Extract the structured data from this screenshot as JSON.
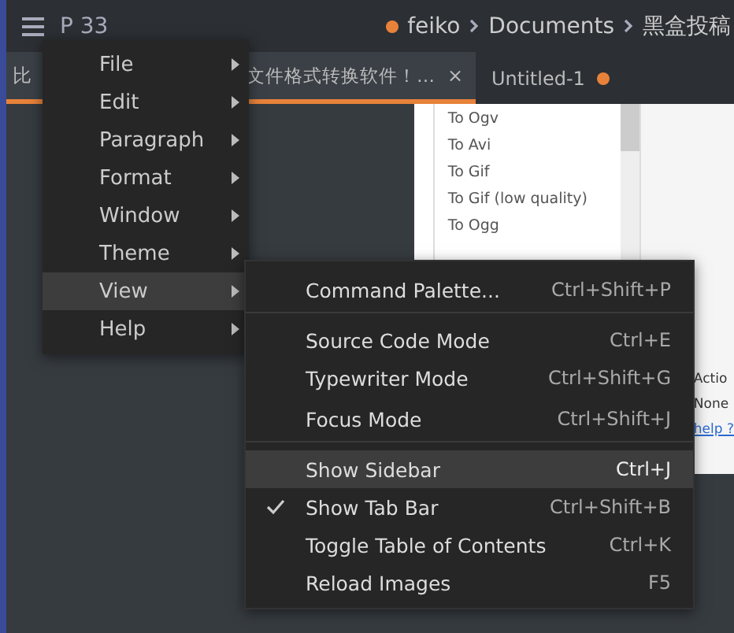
{
  "titlebar": {
    "title": "P 33",
    "breadcrumb": [
      "feiko",
      "Documents",
      "黑盒投稿"
    ],
    "unsaved": true
  },
  "tabs": [
    {
      "label_start": "比",
      "label_end": "文件格式转换软件！…",
      "close": "×",
      "selected": true,
      "unsaved": false
    },
    {
      "label_start": "Untitled-1",
      "selected": false,
      "unsaved": true
    }
  ],
  "embedded": {
    "list": [
      "To Ogv",
      "To Avi",
      "To Gif",
      "To Gif (low quality)",
      "To Ogg"
    ],
    "side_texts": [
      "Actio",
      "None"
    ],
    "link": "help ?"
  },
  "menu": [
    {
      "label": "File",
      "selected": false
    },
    {
      "label": "Edit",
      "selected": false
    },
    {
      "label": "Paragraph",
      "selected": false
    },
    {
      "label": "Format",
      "selected": false
    },
    {
      "label": "Window",
      "selected": false
    },
    {
      "label": "Theme",
      "selected": false
    },
    {
      "label": "View",
      "selected": true
    },
    {
      "label": "Help",
      "selected": false
    }
  ],
  "submenu": [
    {
      "label": "Command Palette...",
      "shortcut": "Ctrl+Shift+P",
      "selected": false,
      "checked": false,
      "separator_after": true
    },
    {
      "label": "Source Code Mode",
      "shortcut": "Ctrl+E",
      "selected": false,
      "checked": false,
      "separator_after": false
    },
    {
      "label": "Typewriter Mode",
      "shortcut": "Ctrl+Shift+G",
      "selected": false,
      "checked": false,
      "separator_after": false
    },
    {
      "label": "Focus Mode",
      "shortcut": "Ctrl+Shift+J",
      "selected": false,
      "checked": false,
      "separator_after": true
    },
    {
      "label": "Show Sidebar",
      "shortcut": "Ctrl+J",
      "selected": true,
      "checked": false,
      "separator_after": false
    },
    {
      "label": "Show Tab Bar",
      "shortcut": "Ctrl+Shift+B",
      "selected": false,
      "checked": true,
      "separator_after": false
    },
    {
      "label": "Toggle Table of Contents",
      "shortcut": "Ctrl+K",
      "selected": false,
      "checked": false,
      "separator_after": false
    },
    {
      "label": "Reload Images",
      "shortcut": "F5",
      "selected": false,
      "checked": false,
      "separator_after": false
    }
  ]
}
